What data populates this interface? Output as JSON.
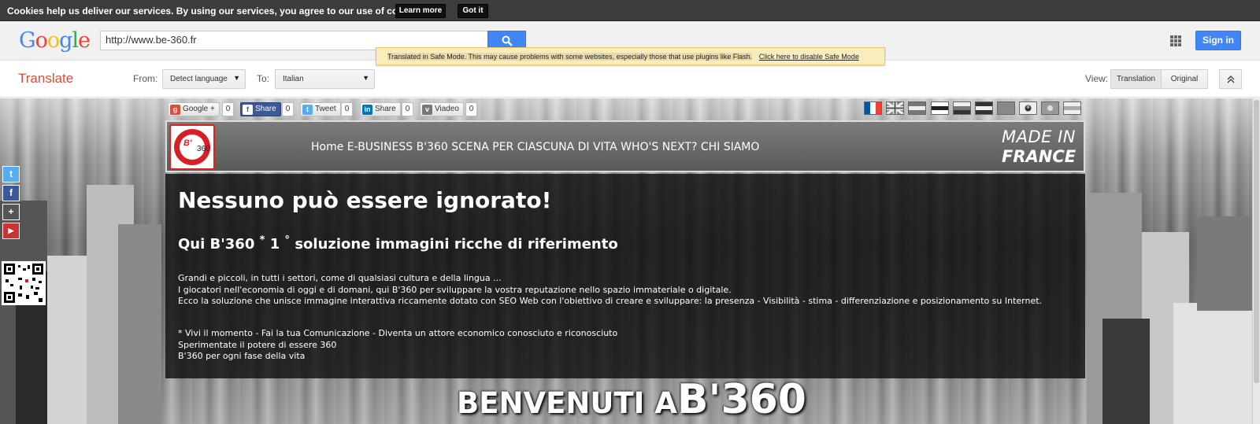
{
  "cookie": {
    "text": "Cookies help us deliver our services. By using our services, you agree to our use of cookies.",
    "learn_more": "Learn more",
    "got_it": "Got it"
  },
  "header": {
    "logo": [
      "G",
      "o",
      "o",
      "g",
      "l",
      "e"
    ],
    "url_value": "http://www.be-360.fr",
    "signin": "Sign in"
  },
  "safe_mode": {
    "message": "Translated in Safe Mode. This may cause problems with some websites, especially those that use plugins like Flash.",
    "link": "Click here to disable Safe Mode"
  },
  "translate_bar": {
    "title": "Translate",
    "from_label": "From:",
    "from_value": "Detect language",
    "to_label": "To:",
    "to_value": "Italian",
    "view_label": "View:",
    "view_translation": "Translation",
    "view_original": "Original"
  },
  "share": {
    "google_label": "Google +",
    "google_count": "0",
    "facebook_label": "Share",
    "facebook_count": "0",
    "twitter_label": "Tweet",
    "twitter_count": "0",
    "linkedin_label": "Share",
    "linkedin_count": "0",
    "viadeo_label": "Viadeo",
    "viadeo_count": "0"
  },
  "site": {
    "logo_text": "B'",
    "logo_sub": "360",
    "nav": "Home E-BUSINESS B'360 SCENA PER CIASCUNA DI VITA WHO'S NEXT? CHI SIAMO",
    "made_in": "MADE IN",
    "france": "FRANCE",
    "headline": "Nessuno può essere ignorato!",
    "subhead_prefix": "Qui B'360",
    "subhead_sup1": "*",
    "subhead_mid": "1",
    "subhead_sup2": "°",
    "subhead_suffix": "soluzione immagini ricche di riferimento",
    "para1_line1": "Grandi e piccoli, in tutti i settori, come di qualsiasi cultura e della lingua ...",
    "para1_line2": "I giocatori nell'economia di oggi e di domani, qui B'360 per sviluppare la vostra reputazione nello spazio immateriale o digitale.",
    "para1_line3": "Ecco la soluzione che unisce immagine interattiva riccamente dotato con SEO Web con l'obiettivo di creare e sviluppare: la presenza - Visibilità - stima - differenziazione e posizionamento su Internet.",
    "para2_line1": "* Vivi il momento - Fai la tua Comunicazione - Diventa un attore economico conosciuto e riconosciuto",
    "para2_line2": "Sperimentate il potere di essere 360",
    "para2_line3": "B'360 per ogni fase della vita",
    "welcome_small": "BENVENUTI A",
    "welcome_big": "B'360"
  },
  "icons": {
    "side": [
      "twitter-icon",
      "facebook-icon",
      "google-plus-icon",
      "youtube-icon"
    ],
    "side_glyphs": [
      "t",
      "f",
      "+",
      "▶"
    ]
  },
  "colors": {
    "google_blue": "#4285f4",
    "translate_red": "#dd4b39",
    "safe_bg": "#f9edbe",
    "logo_red": "#d81f26"
  }
}
